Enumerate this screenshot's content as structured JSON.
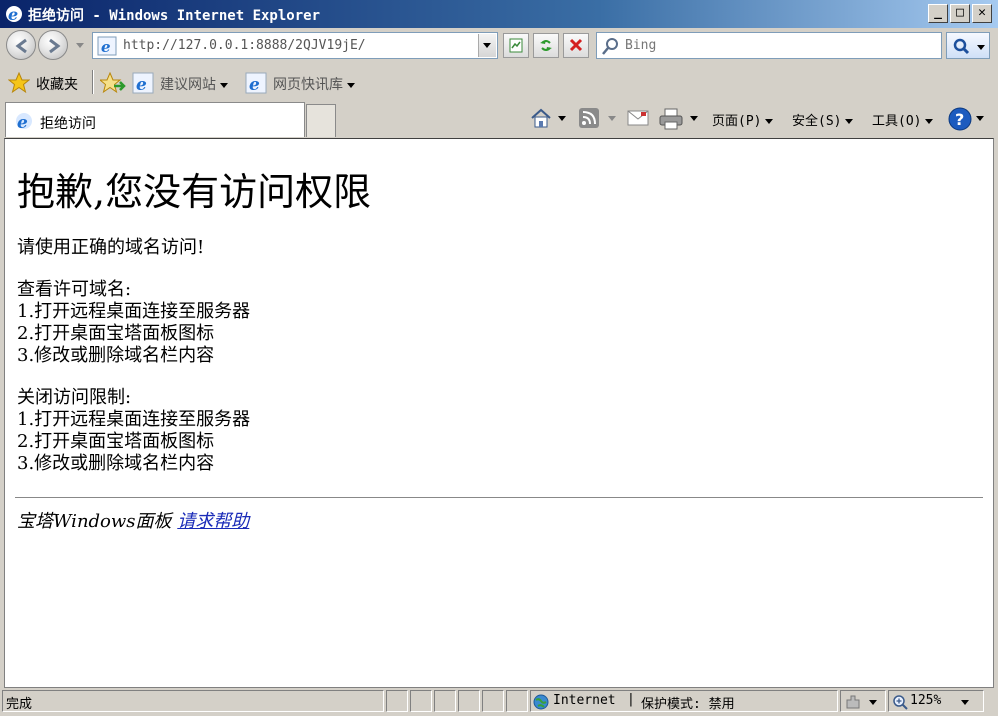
{
  "window": {
    "title": "拒绝访问 - Windows Internet Explorer",
    "controls": {
      "minimize": "_",
      "maximize": "□",
      "close": "✕"
    }
  },
  "toolbar": {
    "address": "http://127.0.0.1:8888/2QJV19jE/",
    "search_placeholder": "Bing"
  },
  "favorites_bar": {
    "favorites_label": "收藏夹",
    "items": [
      "建议网站",
      "网页快讯库"
    ]
  },
  "tabs": [
    {
      "label": "拒绝访问",
      "active": true
    }
  ],
  "command_bar": {
    "page": "页面(P)",
    "safety": "安全(S)",
    "tools": "工具(O)"
  },
  "page": {
    "heading": "抱歉,您没有访问权限",
    "intro": "请使用正确的域名访问!",
    "section1": {
      "title": "查看许可域名:",
      "steps": [
        "1.打开远程桌面连接至服务器",
        "2.打开桌面宝塔面板图标",
        "3.修改或删除域名栏内容"
      ]
    },
    "section2": {
      "title": "关闭访问限制:",
      "steps": [
        "1.打开远程桌面连接至服务器",
        "2.打开桌面宝塔面板图标",
        "3.修改或删除域名栏内容"
      ]
    },
    "footer_text": "宝塔Windows面板",
    "footer_link": "请求帮助"
  },
  "status_bar": {
    "status": "完成",
    "zone": "Internet",
    "protected_mode": "保护模式: 禁用",
    "zoom": "125%"
  },
  "colors": {
    "title_gradient_start": "#0a246a",
    "chrome": "#d4d0c8",
    "link": "#1a2bb8"
  }
}
